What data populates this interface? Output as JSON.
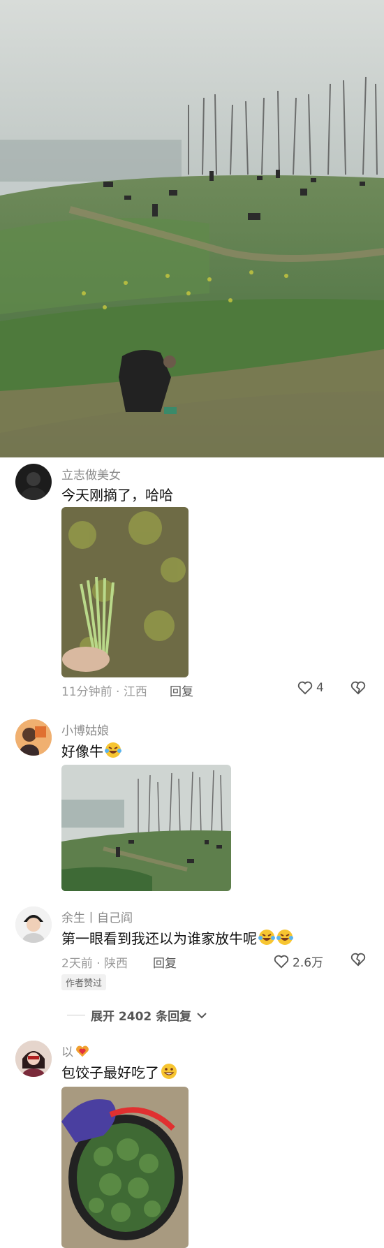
{
  "comments": [
    {
      "username": "立志做美女",
      "text": "今天刚摘了，哈哈",
      "meta": "11分钟前 · 江西",
      "reply_label": "回复",
      "likes": "4"
    },
    {
      "username": "小博姑娘",
      "text": "好像牛"
    },
    {
      "username": "余生丨自己阎",
      "text": "第一眼看到我还以为谁家放牛呢",
      "meta": "2天前 · 陕西",
      "reply_label": "回复",
      "likes": "2.6万",
      "badge": "作者赞过"
    },
    {
      "username": "以",
      "text": "包饺子最好吃了"
    }
  ],
  "expand_replies": "展开 2402 条回复",
  "icons": {
    "like": "heart-outline-icon",
    "dislike": "broken-heart-icon",
    "expand": "chevron-down-icon",
    "emoji_laugh": "laughing-tears-emoji",
    "emoji_grin": "grinning-emoji",
    "emoji_heart_hands": "heart-hands-emoji"
  },
  "colors": {
    "username": "#8a8a8a",
    "text": "#111111",
    "meta": "#9a9a9a"
  }
}
